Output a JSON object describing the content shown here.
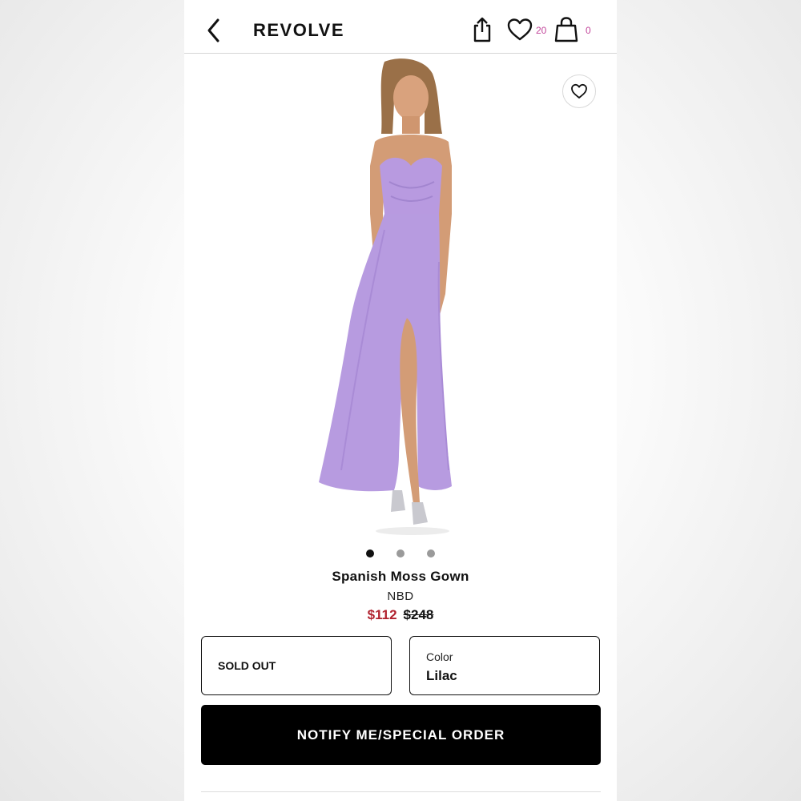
{
  "header": {
    "brand": "REVOLVE",
    "wishlist_count": "20",
    "bag_count": "0",
    "icons": [
      "chevron-left-icon",
      "share-icon",
      "heart-icon",
      "bag-icon"
    ]
  },
  "carousel": {
    "slide_count": 3,
    "active_index": 0
  },
  "product": {
    "name": "Spanish Moss Gown",
    "brand": "NBD",
    "sale_price": "$112",
    "original_price": "$248",
    "dress_color": "#b79be0"
  },
  "size_selector": {
    "value": "SOLD OUT"
  },
  "color_selector": {
    "label": "Color",
    "value": "Lilac"
  },
  "cta": {
    "label": "NOTIFY ME/SPECIAL ORDER"
  },
  "colors": {
    "sale_price": "#b1232f",
    "badge": "#c2459a",
    "button_bg": "#000000"
  }
}
